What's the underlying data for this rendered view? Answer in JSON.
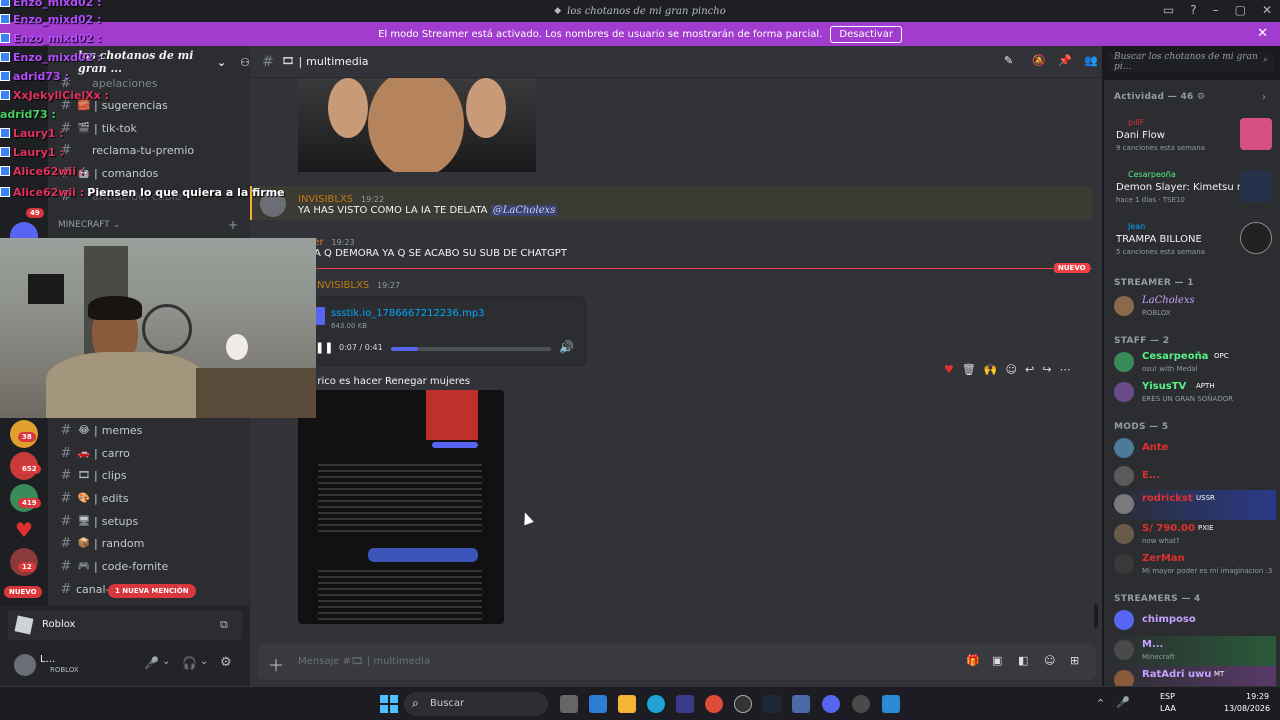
{
  "window": {
    "title": "los chotanos de mi gran pincho"
  },
  "banner": {
    "text": "El modo Streamer está activado. Los nombres de usuario se mostrarán de forma parcial.",
    "button": "Desactivar"
  },
  "server": {
    "name": "los chotanos de mi gran ..."
  },
  "channels_top": [
    {
      "name": "apelaciones",
      "emoji": ""
    },
    {
      "name": "sugerencias",
      "emoji": "🧱"
    },
    {
      "name": "tik-tok",
      "emoji": "🎬"
    },
    {
      "name": "reclama-tu-premio",
      "emoji": ""
    },
    {
      "name": "comandos",
      "emoji": "🤖"
    },
    {
      "name": "anclas-del-cable",
      "emoji": ""
    }
  ],
  "category": {
    "name": "MINECRAFT",
    "plus": "+"
  },
  "channels_bottom": [
    {
      "name": "memes",
      "emoji": "😂"
    },
    {
      "name": "carro",
      "emoji": "🚗"
    },
    {
      "name": "clips",
      "emoji": "🎞"
    },
    {
      "name": "edits",
      "emoji": "🎨"
    },
    {
      "name": "setups",
      "emoji": "🖥"
    },
    {
      "name": "random",
      "emoji": "📦"
    },
    {
      "name": "code-fornite",
      "emoji": "🎮"
    },
    {
      "name": "canal-e...",
      "emoji": ""
    }
  ],
  "mention_pill": "1 NUEVA MENCIÓN",
  "new_pill": "NUEVO",
  "server_badges": [
    "49",
    "38",
    "652",
    "419",
    "12"
  ],
  "activity_bar": {
    "label": "Roblox"
  },
  "user": {
    "name": "L...",
    "status": "ROBLOX"
  },
  "chat": {
    "channel": "multimedia",
    "messages": [
      {
        "author": "INVISIBLXS",
        "time": "19:22",
        "text": "YA HAS VISTO COMO LA IA TE DELATA",
        "mention": "@LaCholexs",
        "color": "#c27c0e"
      },
      {
        "author": "Joger",
        "time": "19:23",
        "text": "A Q DEMORA YA Q SE ACABO SU SUB DE CHATGPT",
        "color": "#e67e22"
      },
      {
        "author": "INVISIBLXS",
        "time": "19:27",
        "text": "",
        "color": "#c27c0e"
      }
    ],
    "new_label": "NUEVO",
    "attachment": {
      "filename": "ssstik.io_1786667212236.mp3",
      "size": "643.00 KB",
      "time": "0:07 / 0:41",
      "progress": 0.17
    },
    "caption": "e rico es hacer Renegar mujeres",
    "input_placeholder": "Mensaje #🎞 | multimedia"
  },
  "search": {
    "placeholder": "Buscar los chotanos de mi gran pi..."
  },
  "members": {
    "activity_title": "Actividad — 46",
    "activity": [
      {
        "name": "Dani Flow",
        "user": "pillF",
        "status": "9 canciones esta semana"
      },
      {
        "name": "Demon Slayer: Kimetsu no ...",
        "user": "Cesarpeoña",
        "status": "hace 1 días · TSE10"
      },
      {
        "name": "TRAMPA BILLONE",
        "user": "Jean",
        "status": "5 canciones esta semana"
      }
    ],
    "streamer_title": "STREAMER — 1",
    "streamer": [
      {
        "name": "LaCholexs",
        "status": "ROBLOX"
      }
    ],
    "staff_title": "STAFF — 2",
    "staff": [
      {
        "name": "Cesarpeoña",
        "tag": "OPC",
        "status": "osu! with Medal"
      },
      {
        "name": "YisusTV",
        "tag": "APTH",
        "status": "ERES UN GRAN SOÑADOR"
      }
    ],
    "mods_title": "MODS — 5",
    "mods": [
      {
        "name": "Ante",
        "status": ""
      },
      {
        "name": "E...",
        "status": ""
      },
      {
        "name": "rodrickst",
        "tag": "USSR",
        "status": ""
      },
      {
        "name": "S/ 790.00",
        "tag": "PXIE",
        "status": "now what?"
      },
      {
        "name": "ZerMan",
        "status": "Mi mayor poder es mi imaginacion :3"
      }
    ],
    "streamers_title": "STREAMERS — 4",
    "streamers": [
      {
        "name": "chimposo",
        "status": ""
      },
      {
        "name": "M...",
        "status": "Minecraft"
      },
      {
        "name": "RatAdri uwu",
        "tag": "MT",
        "status": ""
      }
    ]
  },
  "overlay": [
    {
      "user": "Enzo_mixd02 :",
      "text": "",
      "color": "#b44cff"
    },
    {
      "user": "Enzo_mixd02 :",
      "text": "",
      "color": "#b44cff"
    },
    {
      "user": "Enzo_mixd02 :",
      "text": "",
      "color": "#b44cff"
    },
    {
      "user": "Enzo_mixd02 :",
      "text": "",
      "color": "#b44cff"
    },
    {
      "user": "adrid73 :",
      "text": "",
      "color": "#e2315f"
    },
    {
      "user": "XxJekyllCielXx :",
      "text": "",
      "color": "#48d15d"
    },
    {
      "user": "adrid73 :",
      "text": "",
      "color": "#e2315f"
    },
    {
      "user": "Laury1 :",
      "text": "",
      "color": "#e2315f"
    },
    {
      "user": "Laury1 :",
      "text": "",
      "color": "#e2315f"
    },
    {
      "user": "Alice62wii :",
      "text": "Piensen lo que quiera a la firme",
      "color": "#e2315f"
    }
  ],
  "taskbar": {
    "search": "Buscar",
    "lang": "ESP",
    "lang2": "LAA",
    "time": "19:29",
    "date": "13/08/2026"
  }
}
